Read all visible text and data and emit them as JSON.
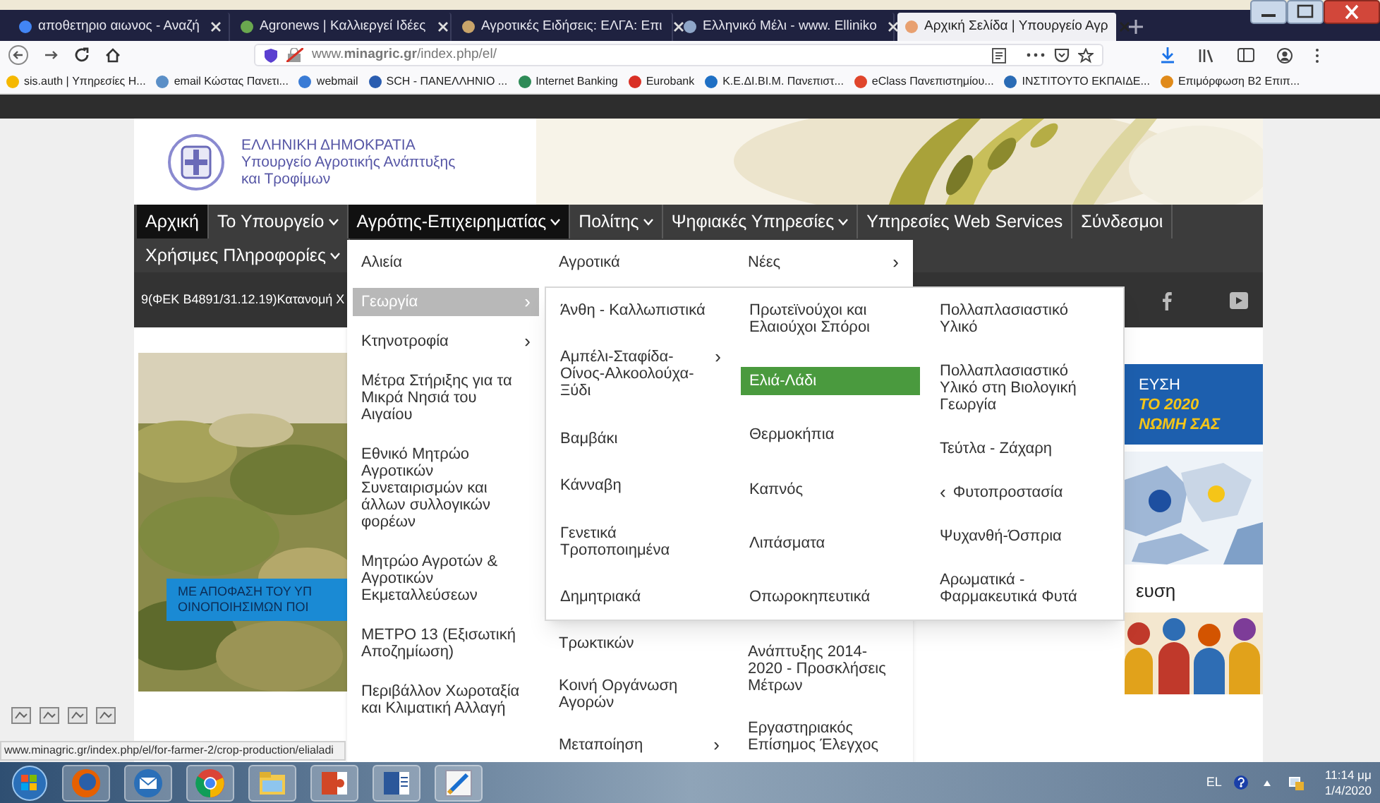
{
  "browser": {
    "tabs": [
      {
        "title": "αποθετηριο αιωνος - Αναζή",
        "selected": false,
        "color": "#4285f4"
      },
      {
        "title": "Agronews | Καλλιεργεί Ιδέες",
        "selected": false,
        "color": "#6aa84f"
      },
      {
        "title": "Αγροτικές Ειδήσεις: ΕΛΓΑ: Επι",
        "selected": false,
        "color": "#c9a46a"
      },
      {
        "title": "Ελληνικό Μέλι - www. Elliniko",
        "selected": false,
        "color": "#8fa6c8"
      },
      {
        "title": "Αρχική Σελίδα | Υπουργείο Αγρ",
        "selected": true,
        "color": "#e8a070"
      }
    ],
    "url": "www.**minagric.gr**/index.php/el/",
    "bookmarks": [
      {
        "label": "sis.auth | Υπηρεσίες Η...",
        "color": "#f5b800"
      },
      {
        "label": "email Κώστας Πανετι...",
        "color": "#5b8fc7"
      },
      {
        "label": "webmail",
        "color": "#3a7bd5"
      },
      {
        "label": "SCH - ΠΑΝΕΛΛΗΝΙΟ ...",
        "color": "#2a5db0"
      },
      {
        "label": "Internet Banking",
        "color": "#2e8b57"
      },
      {
        "label": "Eurobank",
        "color": "#d93025"
      },
      {
        "label": "Κ.Ε.ΔΙ.ΒΙ.Μ. Πανεπιστ...",
        "color": "#1e6fc4"
      },
      {
        "label": "eClass Πανεπιστημίου...",
        "color": "#e0452b"
      },
      {
        "label": "ΙΝΣΤΙΤΟΥΤΟ ΕΚΠΑΙΔΕ...",
        "color": "#2a6bb5"
      },
      {
        "label": "Επιμόρφωση Β2 Επιπ...",
        "color": "#e08a1a"
      }
    ]
  },
  "site": {
    "header": [
      "ΕΛΛΗΝΙΚΗ ΔΗΜΟΚΡΑΤΙΑ",
      "Υπουργείο Αγροτικής Ανάπτυξης",
      "και Τροφίμων"
    ],
    "nav": [
      {
        "label": "Αρχική",
        "selected": true,
        "caret": false
      },
      {
        "label": "Το Υπουργείο",
        "selected": false,
        "caret": true
      },
      {
        "label": "Αγρότης-Επιχειρηματίας",
        "selected": true,
        "caret": true
      },
      {
        "label": "Πολίτης",
        "selected": false,
        "caret": true
      },
      {
        "label": "Ψηφιακές Υπηρεσίες",
        "selected": false,
        "caret": true
      },
      {
        "label": "Υπηρεσίες Web Services",
        "selected": false,
        "caret": false
      },
      {
        "label": "Σύνδεσμοι",
        "selected": false,
        "caret": false
      },
      {
        "label": "Χρήσιμες Πληροφορίες",
        "selected": false,
        "caret": true
      }
    ],
    "ticker": "9(ΦΕΚ Β4891/31.12.19)Κατανομή Χ",
    "left_banner": [
      "ΜΕ ΑΠΟΦΑΣΗ ΤΟΥ ΥΠ",
      "ΟΙΝΟΠΟΙΗΣΙΜΩΝ ΠΟΙ"
    ],
    "right_banner": [
      "ΕΥΣΗ",
      "ΤΟ 2020",
      "ΝΩΜΗ ΣΑΣ"
    ],
    "right_heading": "ευση"
  },
  "menu": {
    "columns": [
      [
        {
          "label": "Αλιεία",
          "selected": false
        },
        {
          "label": "Γεωργία",
          "selected": true,
          "arrow_after": "›"
        },
        {
          "label": "Κτηνοτροφία",
          "selected": false,
          "arrow_after": "›"
        },
        {
          "label": "Μέτρα Στήριξης για τα Μικρά Νησιά του Αιγαίου",
          "selected": false
        },
        {
          "label": "Εθνικό Μητρώο Αγροτικών Συνεταιρισμών και άλλων συλλογικών φορέων",
          "selected": false
        },
        {
          "label": "Μητρώο Αγροτών & Αγροτικών Εκμεταλλεύσεων",
          "selected": false
        },
        {
          "label": "ΜΕΤΡΟ 13 (Εξισωτική Αποζημίωση)",
          "selected": false
        },
        {
          "label": "Περιβάλλον Χωροταξία και Κλιματική Αλλαγή",
          "selected": false
        }
      ],
      [
        {
          "label": "Αγροτικά",
          "selected": false
        },
        {
          "label": "Τρωκτικών",
          "selected": false
        },
        {
          "label": "Κοινή Οργάνωση Αγορών",
          "selected": false
        },
        {
          "label": "Μεταποίηση",
          "selected": false,
          "arrow_after": "›"
        }
      ],
      [
        {
          "label": "Νέες",
          "selected": false,
          "arrow_after": "›"
        },
        {
          "label": "Ανάπτυξης 2014-2020 - Προσκλήσεις Μέτρων",
          "selected": false
        },
        {
          "label": "Εργαστηριακός Επίσημος Έλεγχος",
          "selected": false
        }
      ]
    ]
  },
  "submenu": {
    "columns": [
      [
        {
          "label": "Άνθη - Καλλωπιστικά",
          "selected": false
        },
        {
          "label": "Αμπέλι-Σταφίδα-Οίνος-Αλκοολούχα-Ξύδι",
          "selected": false,
          "arrow_after": "›"
        },
        {
          "label": "Βαμβάκι",
          "selected": false
        },
        {
          "label": "Κάνναβη",
          "selected": false
        },
        {
          "label": "Γενετικά Τροποποιημένα",
          "selected": false
        },
        {
          "label": "Δημητριακά",
          "selected": false
        }
      ],
      [
        {
          "label": "Πρωτεϊνούχοι και Ελαιούχοι Σπόροι",
          "selected": false
        },
        {
          "label": "Ελιά-Λάδι",
          "selected": true
        },
        {
          "label": "Θερμοκήπια",
          "selected": false
        },
        {
          "label": "Καπνός",
          "selected": false
        },
        {
          "label": "Λιπάσματα",
          "selected": false
        },
        {
          "label": "Οπωροκηπευτικά",
          "selected": false
        }
      ],
      [
        {
          "label": "Πολλαπλασιαστικό Υλικό",
          "selected": false
        },
        {
          "label": "Πολλαπλασιαστικό Υλικό στη Βιολογική Γεωργία",
          "selected": false
        },
        {
          "label": "Τεύτλα - Ζάχαρη",
          "selected": false
        },
        {
          "label": "Φυτοπροστασία",
          "selected": false,
          "arrow_before": "‹"
        },
        {
          "label": "Ψυχανθή-Όσπρια",
          "selected": false
        },
        {
          "label": "Αρωματικά - Φαρμακευτικά Φυτά",
          "selected": false
        }
      ]
    ]
  },
  "status_url": "www.minagric.gr/index.php/el/for-farmer-2/crop-production/elialadi",
  "taskbar": {
    "language": "EL",
    "time": "11:14 μμ",
    "date": "1/4/2020"
  }
}
